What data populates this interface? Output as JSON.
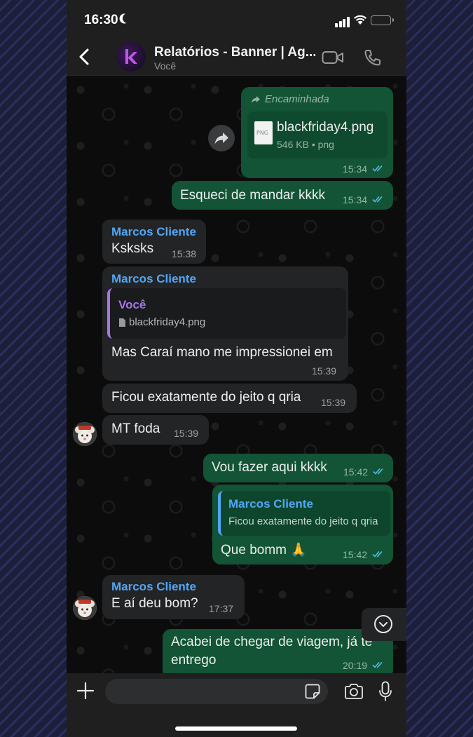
{
  "status_bar": {
    "time": "16:30"
  },
  "header": {
    "title": "Relatórios - Banner | Ag...",
    "subtitle": "Você"
  },
  "messages": [
    {
      "forwarded_label": "Encaminhada",
      "file_name": "blackfriday4.png",
      "file_meta": "546 KB • png",
      "file_type": "PNG",
      "time": "15:34"
    },
    {
      "text": "Esqueci de mandar kkkk",
      "time": "15:34"
    },
    {
      "sender": "Marcos Cliente",
      "text": "Ksksks",
      "time": "15:38"
    },
    {
      "sender": "Marcos Cliente",
      "quote_author": "Você",
      "quote_text": "blackfriday4.png",
      "text": "Mas Caraí mano me impressionei em",
      "time": "15:39"
    },
    {
      "text": "Ficou exatamente do jeito q qria",
      "time": "15:39"
    },
    {
      "text": "MT foda",
      "time": "15:39"
    },
    {
      "text": "Vou fazer aqui kkkk",
      "time": "15:42"
    },
    {
      "quote_author": "Marcos Cliente",
      "quote_text": "Ficou exatamente do jeito q qria",
      "text": "Que bomm 🙏",
      "time": "15:42"
    },
    {
      "sender": "Marcos Cliente",
      "text": "E aí deu bom?",
      "time": "17:37"
    },
    {
      "text_line1": "Acabei de chegar de viagem, já te",
      "text_line2": "entrego",
      "time": "20:19"
    }
  ],
  "input": {
    "placeholder": ""
  },
  "icons": {
    "back": "chevron-left-icon",
    "video": "video-camera-icon",
    "call": "phone-icon",
    "forward": "forward-arrow-icon",
    "read": "double-check-icon",
    "scroll": "chevron-down-icon",
    "attach": "plus-icon",
    "sticker": "sticker-icon",
    "camera": "camera-icon",
    "mic": "microphone-icon"
  },
  "colors": {
    "outgoing_bubble": "#125435",
    "incoming_bubble": "#232426",
    "sender_name": "#53a6f5",
    "read_ticks": "#53bdeb",
    "quote_you": "#a774e8"
  }
}
